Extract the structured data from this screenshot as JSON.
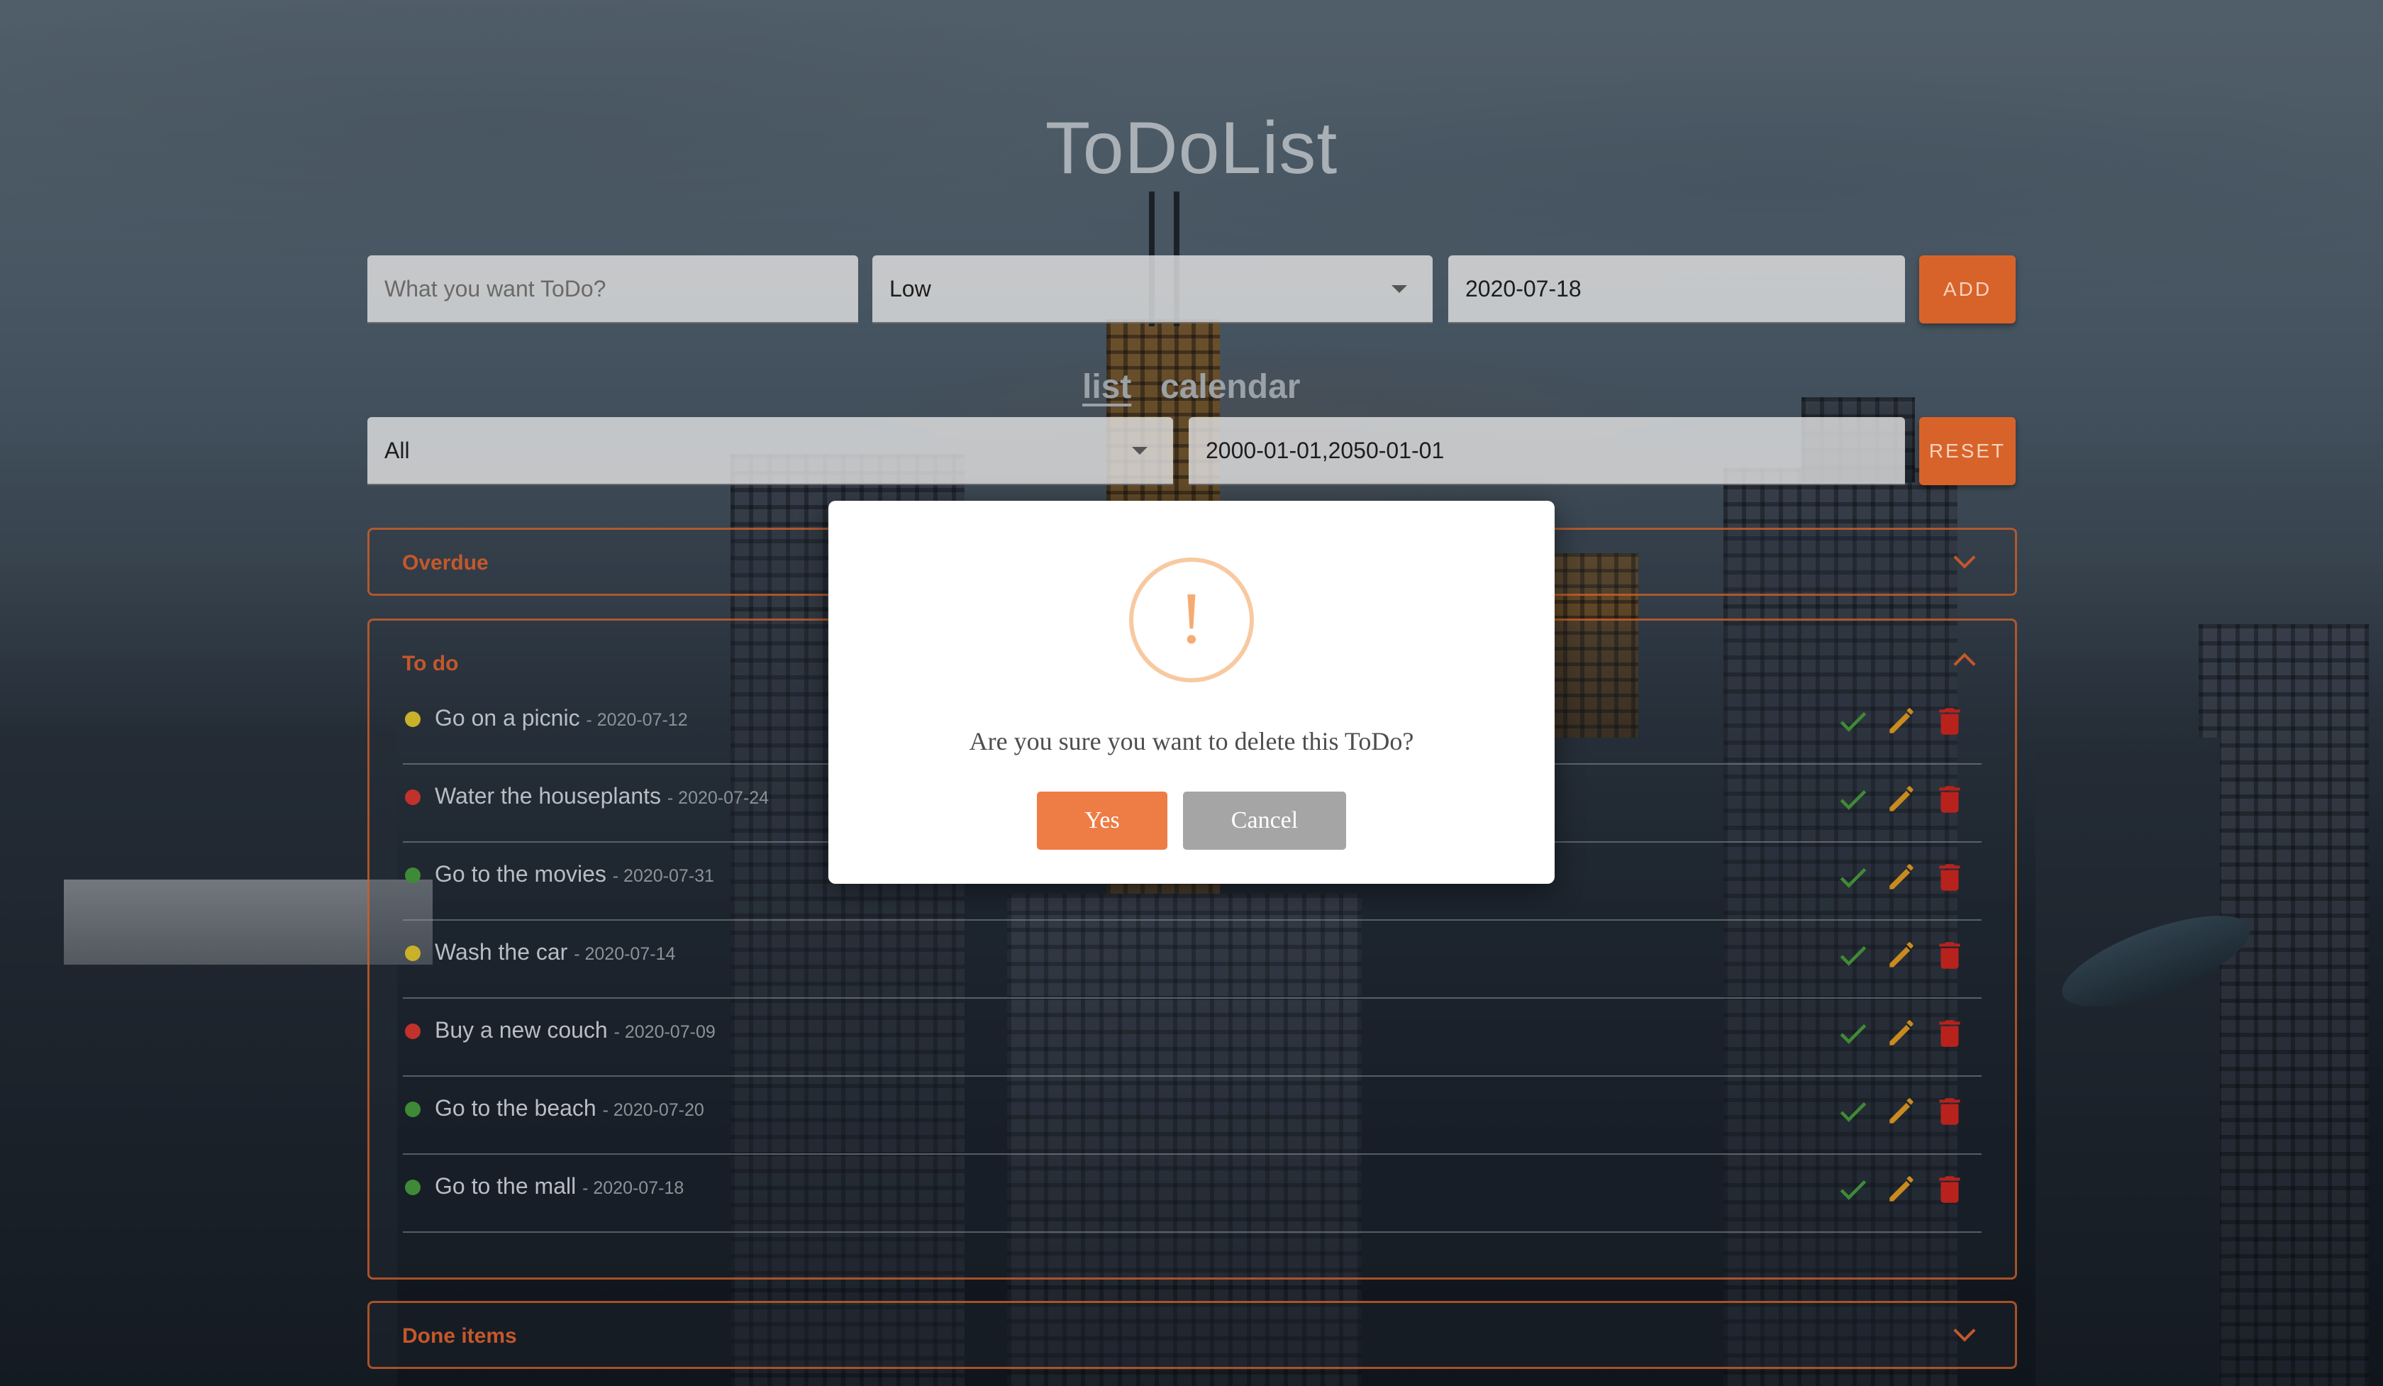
{
  "app": {
    "title": "ToDoList"
  },
  "add_form": {
    "todo_placeholder": "What you want ToDo?",
    "todo_value": "",
    "priority_value": "Low",
    "date_value": "2020-07-18",
    "add_label": "ADD"
  },
  "views": {
    "list_label": "list",
    "calendar_label": "calendar",
    "active": "list"
  },
  "filters": {
    "status_value": "All",
    "range_value": "2000-01-01,2050-01-01",
    "reset_label": "RESET"
  },
  "sections": {
    "overdue_title": "Overdue",
    "todo_title": "To do",
    "done_title": "Done items"
  },
  "todos": [
    {
      "title": "Go on a picnic",
      "date": "- 2020-07-12",
      "priority_color": "#c9b12a"
    },
    {
      "title": "Water the houseplants",
      "date": "- 2020-07-24",
      "priority_color": "#c0322b"
    },
    {
      "title": "Go to the movies",
      "date": "- 2020-07-31",
      "priority_color": "#3f8a36"
    },
    {
      "title": "Wash the car",
      "date": "- 2020-07-14",
      "priority_color": "#c9b12a"
    },
    {
      "title": "Buy a new couch",
      "date": "- 2020-07-09",
      "priority_color": "#c0322b"
    },
    {
      "title": "Go to the beach",
      "date": "- 2020-07-20",
      "priority_color": "#3f8a36"
    },
    {
      "title": "Go to the mall",
      "date": "- 2020-07-18",
      "priority_color": "#3f8a36"
    }
  ],
  "row_icons": {
    "done": "check-icon",
    "edit": "pencil-icon",
    "delete": "trash-icon"
  },
  "colors": {
    "accent": "#d8632a",
    "check": "#3f8a36",
    "edit": "#c98a1e",
    "delete": "#b8221d"
  },
  "modal": {
    "icon": "warning-icon",
    "icon_glyph": "!",
    "message": "Are you sure you want to delete this ToDo?",
    "confirm_label": "Yes",
    "cancel_label": "Cancel",
    "confirm_color": "#ee7c45",
    "cancel_color": "#a5a5a5"
  }
}
